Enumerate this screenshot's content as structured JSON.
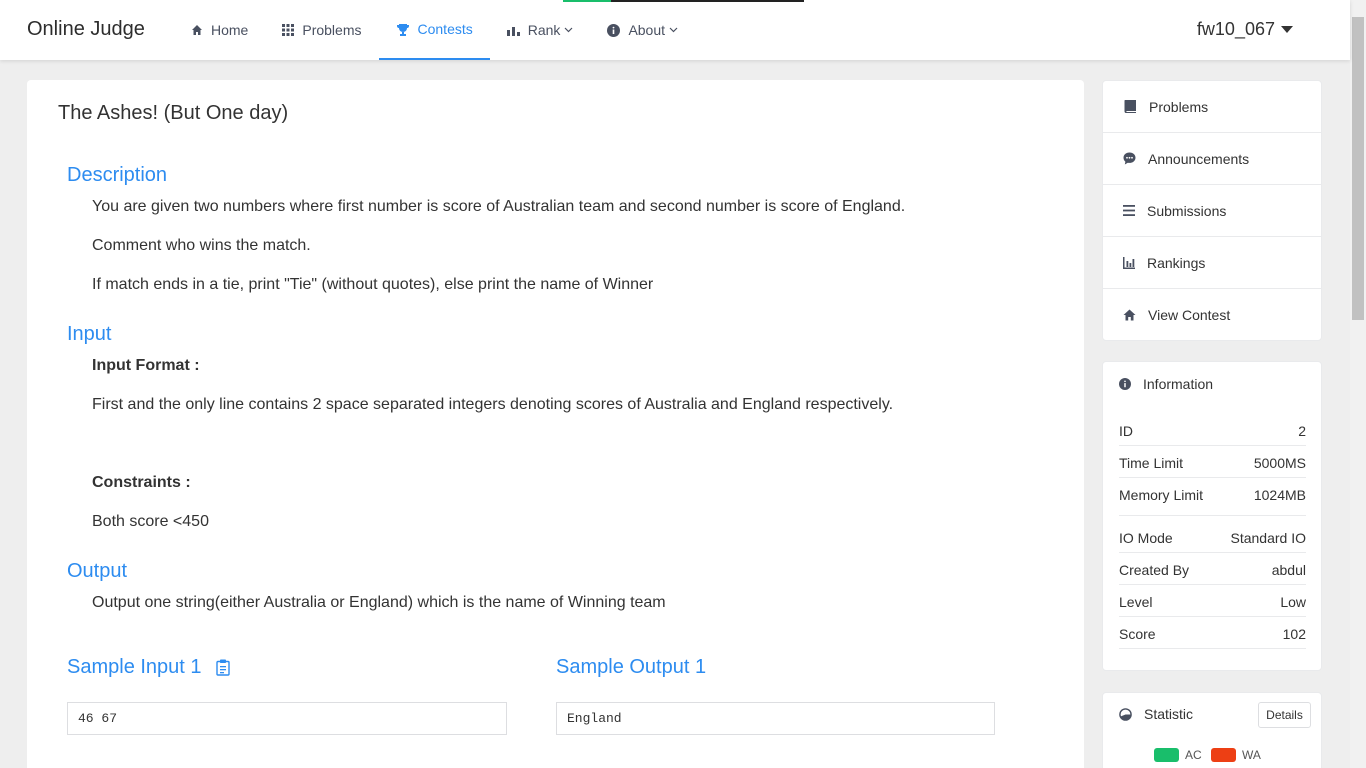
{
  "header": {
    "logo": "Online Judge",
    "nav": [
      {
        "label": "Home"
      },
      {
        "label": "Problems"
      },
      {
        "label": "Contests"
      },
      {
        "label": "Rank"
      },
      {
        "label": "About"
      }
    ],
    "user": "fw10_067"
  },
  "problem": {
    "title": "The Ashes! (But One day)",
    "description_title": "Description",
    "description": [
      "You are given two numbers where first number is score of Australian team and second number is score of England.",
      "Comment who wins the match.",
      "If match ends in a tie, print \"Tie\" (without quotes), else print the name of Winner"
    ],
    "input_title": "Input",
    "input_format_label": "Input Format :",
    "input_format": "First and the only line contains 2 space separated integers denoting scores of Australia and England respectively.",
    "constraints_label": "Constraints :",
    "constraints": "Both score <450",
    "output_title": "Output",
    "output": "Output one string(either Australia or England) which is the name of Winning team",
    "sample_input_title": "Sample Input 1",
    "sample_input": "46 67",
    "sample_output_title": "Sample Output 1",
    "sample_output": "England"
  },
  "sidebar": {
    "menu": [
      {
        "label": "Problems"
      },
      {
        "label": "Announcements"
      },
      {
        "label": "Submissions"
      },
      {
        "label": "Rankings"
      },
      {
        "label": "View Contest"
      }
    ],
    "info_title": "Information",
    "info": [
      {
        "key": "ID",
        "value": "2"
      },
      {
        "key": "Time Limit",
        "value": "5000MS"
      },
      {
        "key": "Memory Limit",
        "value": "1024MB"
      },
      {
        "key": "IO Mode",
        "value": "Standard IO"
      },
      {
        "key": "Created By",
        "value": "abdul"
      },
      {
        "key": "Level",
        "value": "Low"
      },
      {
        "key": "Score",
        "value": "102"
      }
    ],
    "statistic_title": "Statistic",
    "details_label": "Details",
    "legend": [
      {
        "label": "AC",
        "color": "#19be6b"
      },
      {
        "label": "WA",
        "color": "#ed3f14"
      }
    ]
  },
  "colors": {
    "accent": "#2d8cf0"
  }
}
